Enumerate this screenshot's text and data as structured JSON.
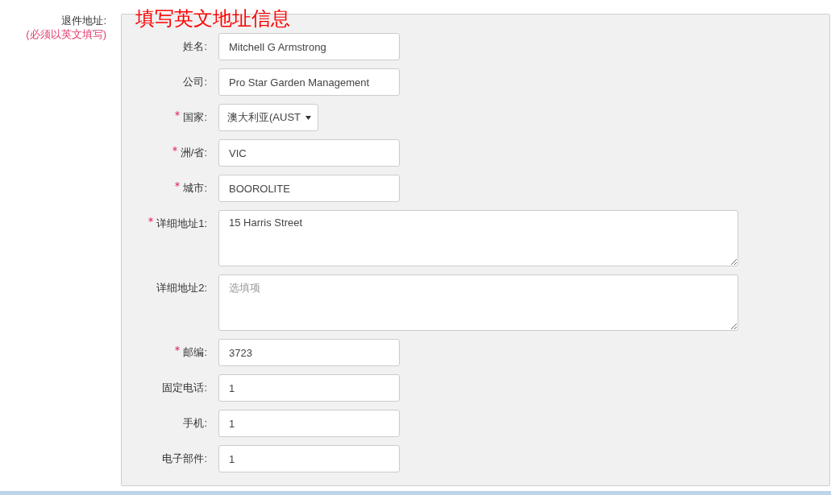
{
  "section": {
    "label": "退件地址:",
    "note": "(必须以英文填写)",
    "title": "填写英文地址信息"
  },
  "fields": [
    {
      "kind": "text",
      "label": "姓名:",
      "required": false,
      "value": "Mitchell G Armstrong"
    },
    {
      "kind": "text",
      "label": "公司:",
      "required": false,
      "value": "Pro Star Garden Management"
    },
    {
      "kind": "select",
      "label": "国家:",
      "required": true,
      "value": "澳大利亚(AUST"
    },
    {
      "kind": "text",
      "label": "洲/省:",
      "required": true,
      "value": "VIC"
    },
    {
      "kind": "text",
      "label": "城市:",
      "required": true,
      "value": "BOOROLITE"
    },
    {
      "kind": "textarea",
      "label": "详细地址1:",
      "required": true,
      "value": "15 Harris Street"
    },
    {
      "kind": "textarea",
      "label": "详细地址2:",
      "required": false,
      "placeholder": "选填项"
    },
    {
      "kind": "text",
      "label": "邮编:",
      "required": true,
      "value": "3723"
    },
    {
      "kind": "text",
      "label": "固定电话:",
      "required": false,
      "value": "1"
    },
    {
      "kind": "text",
      "label": "手机:",
      "required": false,
      "value": "1"
    },
    {
      "kind": "text",
      "label": "电子部件:",
      "required": false,
      "value": "1"
    }
  ]
}
